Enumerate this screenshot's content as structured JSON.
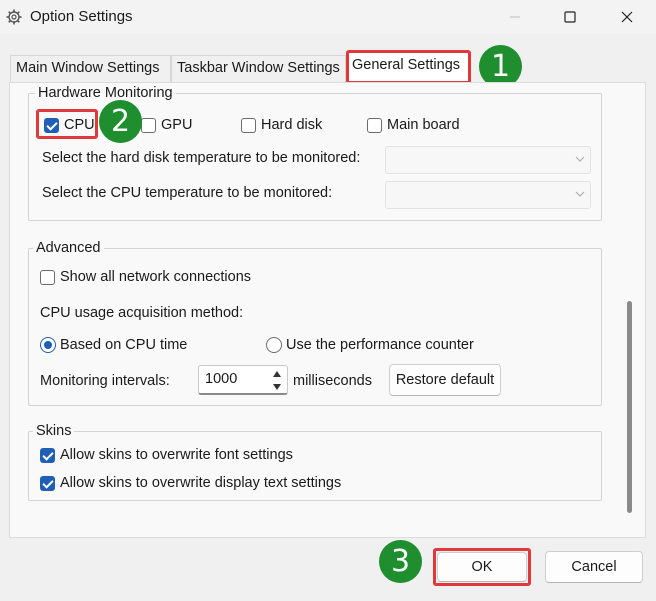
{
  "window": {
    "title": "Option Settings",
    "minimize_icon": "minimize-icon",
    "maximize_icon": "maximize-icon",
    "close_icon": "close-icon"
  },
  "tabs": [
    {
      "label": "Main Window Settings",
      "active": false
    },
    {
      "label": "Taskbar Window Settings",
      "active": false
    },
    {
      "label": "General Settings",
      "active": true
    }
  ],
  "hardware": {
    "title": "Hardware Monitoring",
    "items": [
      {
        "label": "CPU",
        "checked": true
      },
      {
        "label": "GPU",
        "checked": false
      },
      {
        "label": "Hard disk",
        "checked": false
      },
      {
        "label": "Main board",
        "checked": false
      }
    ],
    "disk_temp_label": "Select the hard disk temperature to be monitored:",
    "disk_temp_value": "",
    "cpu_temp_label": "Select the CPU temperature to be monitored:",
    "cpu_temp_value": ""
  },
  "advanced": {
    "title": "Advanced",
    "show_network_label": "Show all network connections",
    "show_network_checked": false,
    "cpu_method_label": "CPU usage acquisition method:",
    "method_options": [
      {
        "label": "Based on CPU time",
        "selected": true
      },
      {
        "label": "Use the performance counter",
        "selected": false
      }
    ],
    "interval_label": "Monitoring intervals:",
    "interval_value": "1000",
    "interval_unit": "milliseconds",
    "restore_label": "Restore default"
  },
  "skins": {
    "title": "Skins",
    "items": [
      {
        "label": "Allow skins to overwrite font settings",
        "checked": true
      },
      {
        "label": "Allow skins to overwrite display text settings",
        "checked": true
      }
    ]
  },
  "footer": {
    "ok_label": "OK",
    "cancel_label": "Cancel"
  },
  "annotations": {
    "step1": "1",
    "step2": "2",
    "step3": "3",
    "highlight_color": "#e0383b",
    "badge_color": "#1e8e2e"
  },
  "colors": {
    "accent": "#1f5fb5"
  }
}
